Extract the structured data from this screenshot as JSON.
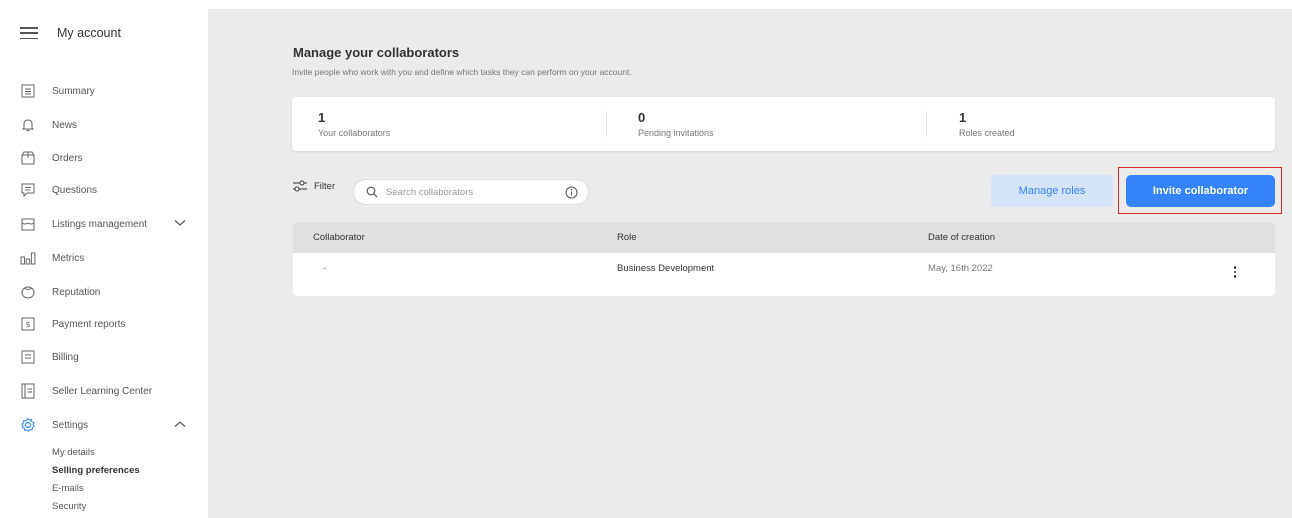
{
  "sidebar": {
    "title": "My account",
    "items": [
      {
        "label": "Summary",
        "icon": "summary-icon"
      },
      {
        "label": "News",
        "icon": "bell-icon"
      },
      {
        "label": "Orders",
        "icon": "box-icon"
      },
      {
        "label": "Questions",
        "icon": "chat-icon"
      },
      {
        "label": "Listings management",
        "icon": "store-icon"
      },
      {
        "label": "Metrics",
        "icon": "bars-icon"
      },
      {
        "label": "Reputation",
        "icon": "badge-icon"
      },
      {
        "label": "Payment reports",
        "icon": "dollar-icon"
      },
      {
        "label": "Billing",
        "icon": "receipt-icon"
      },
      {
        "label": "Seller Learning Center",
        "icon": "book-icon"
      },
      {
        "label": "Settings",
        "icon": "gear-icon"
      }
    ],
    "settings_sub": [
      {
        "label": "My details"
      },
      {
        "label": "Selling preferences"
      },
      {
        "label": "E-mails"
      },
      {
        "label": "Security"
      }
    ]
  },
  "page": {
    "title": "Manage your collaborators",
    "subtitle": "Invite people who work with you and define which tasks they can perform on your account."
  },
  "stats": [
    {
      "value": "1",
      "label": "Your collaborators"
    },
    {
      "value": "0",
      "label": "Pending invitations"
    },
    {
      "value": "1",
      "label": "Roles created"
    }
  ],
  "toolbar": {
    "filter_label": "Filter",
    "search_placeholder": "Search collaborators",
    "manage_roles_label": "Manage roles",
    "invite_label": "Invite collaborator"
  },
  "table": {
    "headers": [
      "Collaborator",
      "Role",
      "Date of creation"
    ],
    "rows": [
      {
        "collaborator": "-",
        "role": "Business Development",
        "date": "May, 16th 2022"
      }
    ]
  },
  "colors": {
    "accent": "#3483fa",
    "accent_light": "#d4e3f7",
    "highlight": "#d62a2a",
    "background": "#ebebeb"
  }
}
